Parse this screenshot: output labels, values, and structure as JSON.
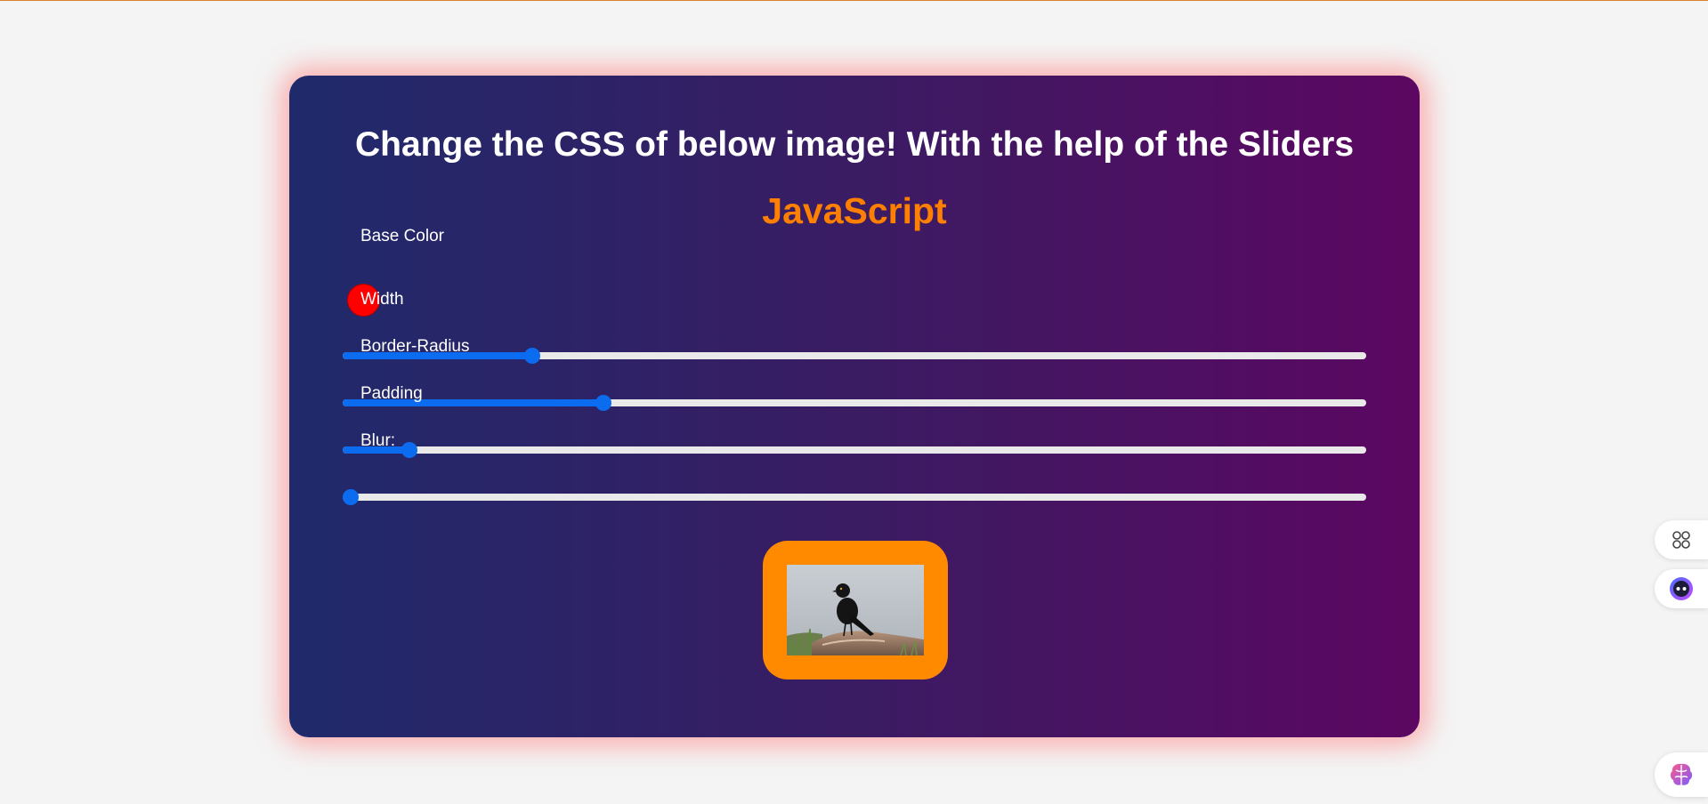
{
  "page": {
    "heading": "Change the CSS of below image! With the help of the Sliders",
    "subheading": "JavaScript"
  },
  "controls": {
    "base_color": {
      "label": "Base Color",
      "value": "#ff0000"
    },
    "sliders": [
      {
        "key": "width",
        "label": "Width",
        "percent": 18.5
      },
      {
        "key": "radius",
        "label": "Border-Radius",
        "percent": 25.5
      },
      {
        "key": "padding",
        "label": "Padding",
        "percent": 6.5
      },
      {
        "key": "blur",
        "label": "Blur:",
        "percent": 0.8
      }
    ]
  },
  "preview": {
    "frame_color": "#ff8a00",
    "image": "bird-on-rock-photo"
  },
  "side_tools": [
    "apps-grid-icon",
    "assistant-face-icon",
    "brain-icon"
  ],
  "colors": {
    "accent": "#0b6cf0",
    "subheading": "#ff8000",
    "gradient_start": "#1f2a6b",
    "gradient_end": "#5c0761"
  }
}
